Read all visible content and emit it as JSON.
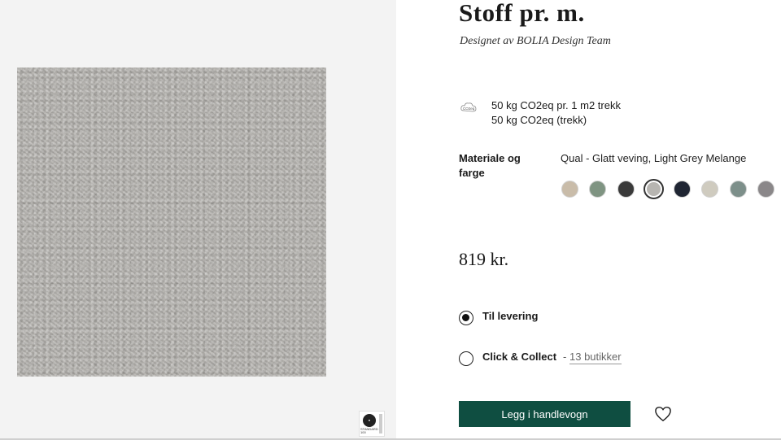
{
  "product": {
    "title": "Stoff pr. m.",
    "designer": "Designet av BOLIA Design Team"
  },
  "co2": {
    "icon": "co2-cloud-icon",
    "icon_text": "CO2eq",
    "line1": "50 kg CO2eq pr. 1 m2 trekk",
    "line2": "50 kg CO2eq (trekk)"
  },
  "material": {
    "label": "Materiale og farge",
    "value": "Qual - Glatt veving, Light Grey Melange",
    "colors": [
      {
        "name": "beige",
        "hex": "#c9bca9"
      },
      {
        "name": "sage-green",
        "hex": "#7f9482"
      },
      {
        "name": "charcoal",
        "hex": "#3a3a3a"
      },
      {
        "name": "light-grey-melange",
        "hex": "#b7b5b1",
        "selected": true
      },
      {
        "name": "navy",
        "hex": "#1f2533"
      },
      {
        "name": "light-stone",
        "hex": "#cfcbbf"
      },
      {
        "name": "grey-green",
        "hex": "#7d8f8a"
      },
      {
        "name": "medium-grey",
        "hex": "#8a8789"
      }
    ]
  },
  "price": "819 kr.",
  "delivery": {
    "option1": "Til levering",
    "option2": "Click & Collect",
    "separator": "-",
    "stores": "13 butikker"
  },
  "cart": {
    "button": "Legg i handlevogn",
    "favorite_icon": "heart-icon"
  },
  "badge": {
    "icon": "oeko-tex-badge-icon",
    "text": "STANDARD 100"
  },
  "colors": {
    "accent": "#0f4e41",
    "left_bg": "#f3f3f3",
    "fabric": "#b4b2ae"
  }
}
